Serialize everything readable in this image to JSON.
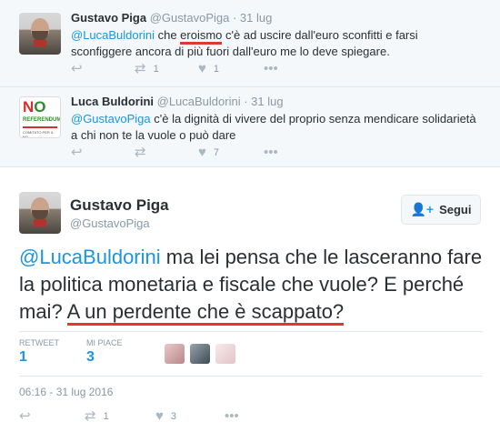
{
  "tweets": [
    {
      "name": "Gustavo Piga",
      "handle": "@GustavoPiga",
      "date": "· 31 lug",
      "mention": "@LucaBuldorini",
      "text_a": " che ",
      "highlight": "eroismo",
      "text_b": " c'è ad uscire dall'euro sconfitti e farsi sconfiggere ancora di più fuori dall'euro me lo deve spiegare.",
      "retweets": "1",
      "likes": "1"
    },
    {
      "name": "Luca Buldorini",
      "handle": "@LucaBuldorini",
      "date": "· 31 lug",
      "mention": "@GustavoPiga",
      "text": " c'è la dignità di vivere del proprio senza mendicare solidarietà a chi non te la vuole o può dare",
      "retweets": "",
      "likes": "7",
      "avatar": {
        "no_n": "N",
        "no_o": "O",
        "ref": "REFERENDUM",
        "sub": "COMITATO PER IL NO"
      }
    }
  ],
  "main": {
    "name": "Gustavo Piga",
    "handle": "@GustavoPiga",
    "follow_label": "Segui",
    "mention": "@LucaBuldorini",
    "text_a": " ma lei pensa che le lasceranno fare la politica monetaria e fiscale che vuole? E perché mai? ",
    "highlight": "A un perdente che è scappato?",
    "retweet_label": "RETWEET",
    "retweet_count": "1",
    "like_label": "MI PIACE",
    "like_count": "3",
    "timestamp": "06:16 - 31 lug 2016",
    "action_retweets": "1",
    "action_likes": "3"
  },
  "icons": [
    "reply-icon",
    "retweet-icon",
    "heart-icon",
    "more-icon",
    "follow-icon"
  ],
  "colors": {
    "link": "#1b95e0",
    "highlight_underline": "#e0382f",
    "muted": "#8899a6"
  }
}
